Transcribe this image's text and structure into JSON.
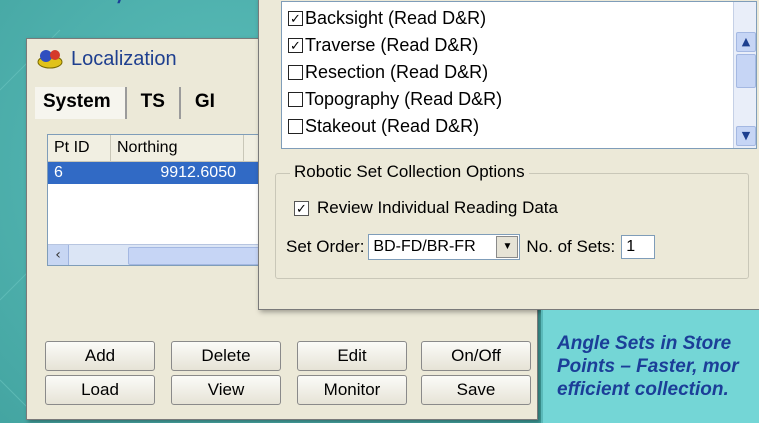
{
  "localization": {
    "title": "Localization",
    "tabs": [
      "System",
      "TS",
      "GI"
    ],
    "list": {
      "headers": [
        "Pt ID",
        "Northing"
      ],
      "rows": [
        {
          "id": "6",
          "northing": "9912.6050"
        }
      ]
    },
    "buttons": {
      "add": "Add",
      "delete": "Delete",
      "edit": "Edit",
      "onoff": "On/Off",
      "load": "Load",
      "view": "View",
      "monitor": "Monitor",
      "save": "Save"
    }
  },
  "sets": {
    "observations": [
      {
        "label": "Backsight (Read D&R)",
        "checked": true
      },
      {
        "label": "Traverse (Read D&R)",
        "checked": true
      },
      {
        "label": "Resection (Read D&R)",
        "checked": false
      },
      {
        "label": "Topography (Read D&R)",
        "checked": false
      },
      {
        "label": "Stakeout (Read D&R)",
        "checked": false
      }
    ],
    "group_label": "Robotic Set Collection Options",
    "review_label": "Review Individual Reading Data",
    "review_checked": true,
    "set_order_label": "Set Order:",
    "set_order_value": "BD-FD/BR-FR",
    "num_sets_label": "No. of Sets:",
    "num_sets_value": "1"
  },
  "promo": {
    "text": "Angle Sets in Store\nPoints – Faster, mor\nefficient collection."
  },
  "colors": {
    "background": "#4aa9a6",
    "promo_bg": "#74d6d6",
    "promo_text": "#1b3e98",
    "selection": "#316ac5"
  }
}
